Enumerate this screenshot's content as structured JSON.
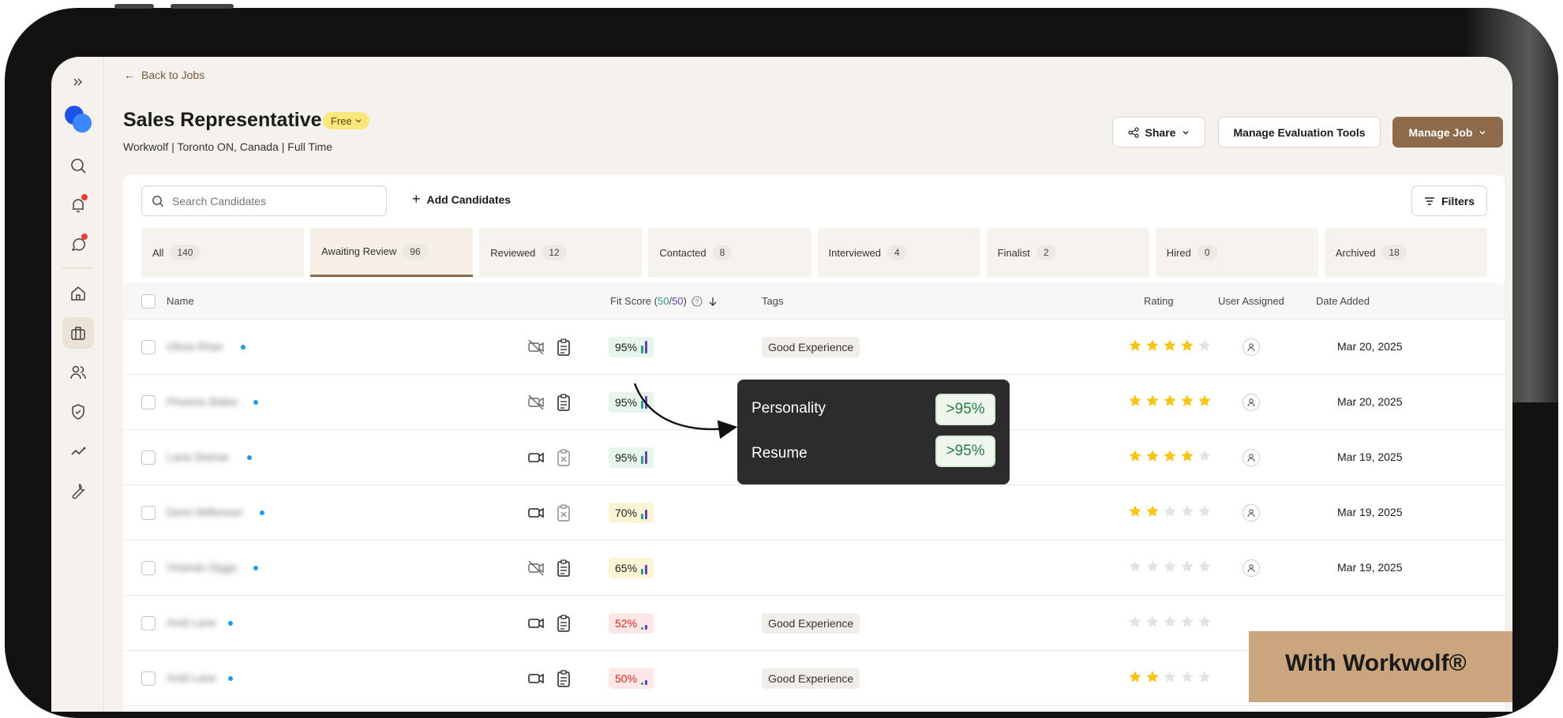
{
  "nav": {
    "back_label": "Back to Jobs"
  },
  "job": {
    "title": "Sales Representative",
    "plan_badge": "Free",
    "meta": "Workwolf | Toronto ON, Canada | Full Time"
  },
  "header_actions": {
    "share": "Share",
    "manage_tools": "Manage Evaluation Tools",
    "manage_job": "Manage Job"
  },
  "toolbar": {
    "search_placeholder": "Search Candidates",
    "add_candidates": "Add Candidates",
    "filters": "Filters"
  },
  "tabs": [
    {
      "label": "All",
      "count": "140"
    },
    {
      "label": "Awaiting Review",
      "count": "96"
    },
    {
      "label": "Reviewed",
      "count": "12"
    },
    {
      "label": "Contacted",
      "count": "8"
    },
    {
      "label": "Interviewed",
      "count": "4"
    },
    {
      "label": "Finalist",
      "count": "2"
    },
    {
      "label": "Hired",
      "count": "0"
    },
    {
      "label": "Archived",
      "count": "18"
    }
  ],
  "table": {
    "headers": {
      "name": "Name",
      "fit_score_prefix": "Fit Score (",
      "fit_a": "50",
      "fit_sep": "/",
      "fit_b": "50",
      "fit_suffix": ")",
      "tags": "Tags",
      "rating": "Rating",
      "user_assigned": "User Assigned",
      "date_added": "Date Added"
    },
    "rows": [
      {
        "name": "Olivia Rhye",
        "video": false,
        "assessment": true,
        "fit": "95%",
        "fit_level": "hi",
        "tag": "Good Experience",
        "rating": 4,
        "date": "Mar 20, 2025"
      },
      {
        "name": "Phoenix Baker",
        "video": false,
        "assessment": true,
        "fit": "95%",
        "fit_level": "hi",
        "tag": "",
        "rating": 5,
        "date": "Mar 20, 2025"
      },
      {
        "name": "Lana Steiner",
        "video": true,
        "assessment": false,
        "fit": "95%",
        "fit_level": "hi",
        "tag": "",
        "rating": 4,
        "date": "Mar 19, 2025"
      },
      {
        "name": "Demi Wilkinson",
        "video": true,
        "assessment": false,
        "fit": "70%",
        "fit_level": "mid",
        "tag": "",
        "rating": 2,
        "date": "Mar 19, 2025"
      },
      {
        "name": "Orlando Diggs",
        "video": false,
        "assessment": true,
        "fit": "65%",
        "fit_level": "mid",
        "tag": "",
        "rating": 0,
        "date": "Mar 19, 2025"
      },
      {
        "name": "Andi Lane",
        "video": true,
        "assessment": true,
        "fit": "52%",
        "fit_level": "lo",
        "tag": "Good Experience",
        "rating": 0,
        "date": ""
      },
      {
        "name": "Andi Lane",
        "video": true,
        "assessment": true,
        "fit": "50%",
        "fit_level": "lo",
        "tag": "Good Experience",
        "rating": 2,
        "date": ""
      }
    ]
  },
  "tooltip": {
    "personality_label": "Personality",
    "personality_value": ">95%",
    "resume_label": "Resume",
    "resume_value": ">95%"
  },
  "ribbon": {
    "text": "With Workwolf®"
  },
  "colors": {
    "accent": "#8c6a4a",
    "star": "#f5c518",
    "star_empty": "#e3e3e3",
    "badge": "#fbe77c",
    "fit_teal": "#2a9d8f",
    "fit_purple": "#6a3fb5"
  }
}
